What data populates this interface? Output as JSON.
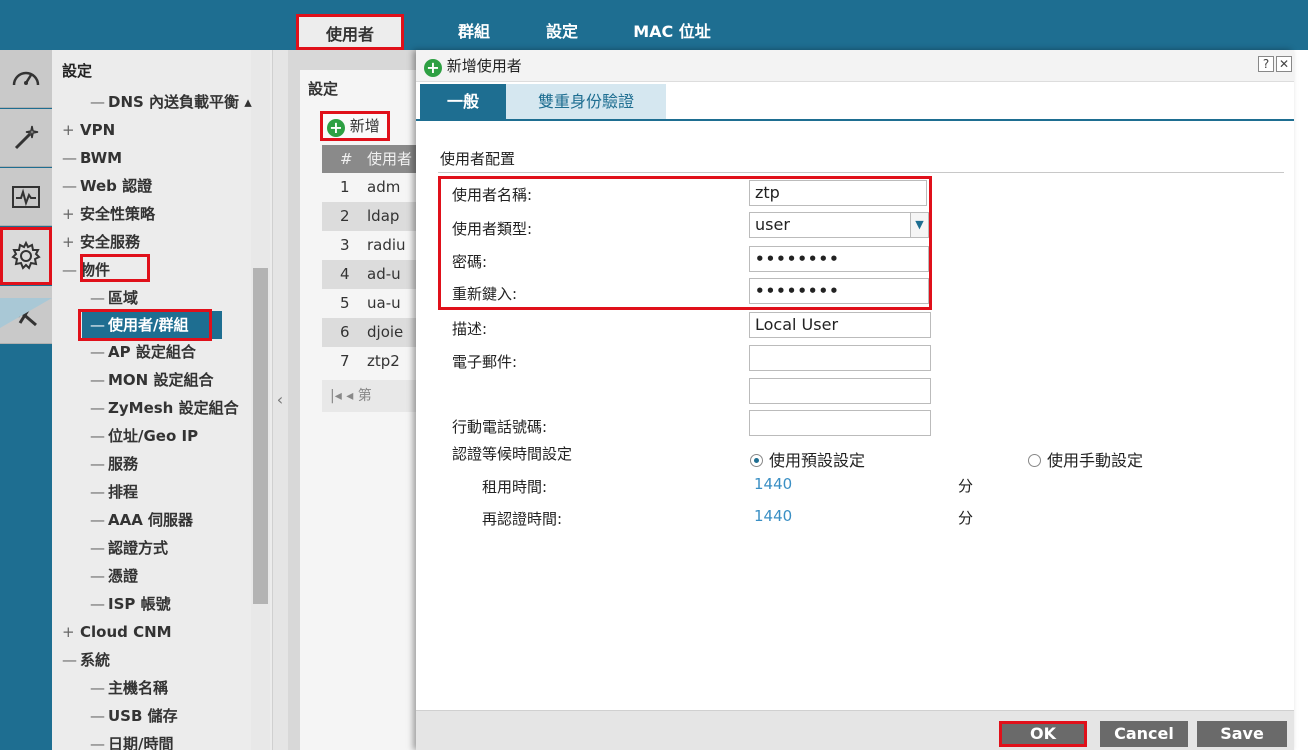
{
  "top_tabs": [
    "使用者",
    "群組",
    "設定",
    "MAC 位址"
  ],
  "rail_icons": [
    "dashboard-icon",
    "wizard-icon",
    "monitor-icon",
    "settings-gear-icon",
    "tools-icon"
  ],
  "sidebar": {
    "title": "設定",
    "items": [
      {
        "sym": "—",
        "label": "DNS 內送負載平衡 ▴"
      },
      {
        "sym": "+",
        "label": "VPN"
      },
      {
        "sym": "—",
        "label": "BWM"
      },
      {
        "sym": "—",
        "label": "Web 認證"
      },
      {
        "sym": "+",
        "label": "安全性策略"
      },
      {
        "sym": "+",
        "label": "安全服務"
      },
      {
        "sym": "—",
        "label": "物件"
      },
      {
        "sym": "—",
        "label": "區域"
      },
      {
        "sym": "—",
        "label": "使用者/群組"
      },
      {
        "sym": "—",
        "label": "AP 設定組合"
      },
      {
        "sym": "—",
        "label": "MON 設定組合"
      },
      {
        "sym": "—",
        "label": "ZyMesh 設定組合"
      },
      {
        "sym": "—",
        "label": "位址/Geo IP"
      },
      {
        "sym": "—",
        "label": "服務"
      },
      {
        "sym": "—",
        "label": "排程"
      },
      {
        "sym": "—",
        "label": "AAA 伺服器"
      },
      {
        "sym": "—",
        "label": "認證方式"
      },
      {
        "sym": "—",
        "label": "憑證"
      },
      {
        "sym": "—",
        "label": "ISP 帳號"
      },
      {
        "sym": "+",
        "label": "Cloud CNM"
      },
      {
        "sym": "—",
        "label": "系統"
      },
      {
        "sym": "—",
        "label": "主機名稱"
      },
      {
        "sym": "—",
        "label": "USB 儲存"
      },
      {
        "sym": "—",
        "label": "日期/時間"
      }
    ]
  },
  "main": {
    "title": "設定",
    "add_label": "新增",
    "grid_header": {
      "num": "#",
      "name": "使用者"
    },
    "rows": [
      {
        "num": "1",
        "name": "adm"
      },
      {
        "num": "2",
        "name": "ldap"
      },
      {
        "num": "3",
        "name": "radiu"
      },
      {
        "num": "4",
        "name": "ad-u"
      },
      {
        "num": "5",
        "name": "ua-u"
      },
      {
        "num": "6",
        "name": "djoie"
      },
      {
        "num": "7",
        "name": "ztp2"
      }
    ],
    "pager_label": "第"
  },
  "dialog": {
    "title": "新增使用者",
    "help": "?",
    "close": "✕",
    "tabs": [
      "一般",
      "雙重身份驗證"
    ],
    "section_title": "使用者配置",
    "fields": {
      "username_label": "使用者名稱:",
      "username_value": "ztp",
      "usertype_label": "使用者類型:",
      "usertype_value": "user",
      "password_label": "密碼:",
      "password_value": "••••••••",
      "retype_label": "重新鍵入:",
      "retype_value": "••••••••",
      "description_label": "描述:",
      "description_value": "Local User",
      "email_label": "電子郵件:",
      "email_value_1": "",
      "email_value_2": "",
      "mobile_label": "行動電話號碼:",
      "mobile_value": ""
    },
    "auth_timeout": {
      "label": "認證等候時間設定",
      "option_default": "使用預設設定",
      "option_manual": "使用手動設定",
      "lease_label": "租用時間:",
      "lease_value": "1440",
      "reauth_label": "再認證時間:",
      "reauth_value": "1440",
      "unit": "分"
    },
    "buttons": {
      "ok": "OK",
      "cancel": "Cancel",
      "save": "Save"
    }
  },
  "colors": {
    "accent": "#1e6e91",
    "highlight": "#e0101a",
    "add_green": "#2ea043",
    "value_blue": "#3a8fc4"
  }
}
